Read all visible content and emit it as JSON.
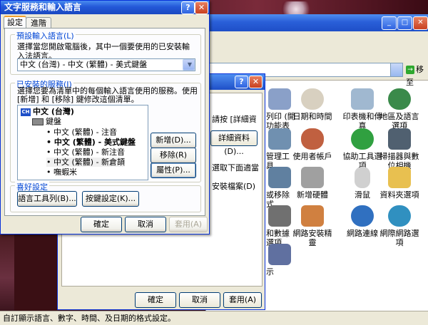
{
  "dialog": {
    "title": "文字服務和輸入語言",
    "help_glyph": "?",
    "close_glyph": "✕",
    "tabs": [
      {
        "label": "設定"
      },
      {
        "label": "進階"
      }
    ],
    "default_group": {
      "label": "預設輸入語言(L)",
      "description": "選擇當您開啟電腦後，其中一個要使用的已安裝輸入法語言。",
      "selected": "中文 (台灣) - 中文 (繁體) - 美式鍵盤"
    },
    "services_group": {
      "label": "已安裝的服務(I)",
      "description": "選擇您要為清單中的每個輸入語言使用的服務。使用 [新增] 和 [移除] 鍵修改這個清單。",
      "language": "中文 (台灣)",
      "language_code": "CH",
      "category": "鍵盤",
      "items": [
        {
          "text": "中文 (繁體) - 注音",
          "bold": false
        },
        {
          "text": "中文 (繁體) - 美式鍵盤",
          "bold": true
        },
        {
          "text": "中文 (繁體) - 新注音",
          "bold": false
        },
        {
          "text": "中文 (繁體) - 新倉頡",
          "bold": false
        },
        {
          "text": "嘸蝦米",
          "bold": false
        }
      ],
      "add_button": "新增(D)...",
      "remove_button": "移除(R)",
      "properties_button": "屬性(P)..."
    },
    "preferences_group": {
      "label": "喜好設定",
      "language_bar_button": "語言工具列(B)...",
      "key_settings_button": "按鍵設定(K)..."
    },
    "ok_button": "確定",
    "cancel_button": "取消",
    "apply_button": "套用(A)"
  },
  "middle_dialog": {
    "help_glyph": "?",
    "close_glyph": "✕",
    "text_1": "請按 [詳細資",
    "details_button": "詳細資料(D)...",
    "text_2": "選取下面適當",
    "text_3": "安裝檔案(D)",
    "ok_button": "確定",
    "cancel_button": "取消",
    "apply_button": "套用(A)"
  },
  "control_panel": {
    "min_glyph": "_",
    "max_glyph": "□",
    "close_glyph": "✕",
    "go_label": "移至",
    "go_glyph": "→",
    "icons": [
      {
        "label": "列印 (開\n功能表",
        "color": "#8aa0c8"
      },
      {
        "label": "日期和時間",
        "color": "#d8d0c0"
      },
      {
        "label": "印表機和傳\n真",
        "color": "#a0b8d0"
      },
      {
        "label": "地區及語言\n選項",
        "color": "#3a8a4a"
      },
      {
        "label": "管理工\n具",
        "color": "#7090b0"
      },
      {
        "label": "使用者帳戶",
        "color": "#c06040"
      },
      {
        "label": "協助工具選\n項",
        "color": "#30a040"
      },
      {
        "label": "掃描器與數\n位相機",
        "color": "#506070"
      },
      {
        "label": "或移除\n式",
        "color": "#6080a0"
      },
      {
        "label": "新增硬體",
        "color": "#a0a0a0"
      },
      {
        "label": "滑鼠",
        "color": "#d0d0d0"
      },
      {
        "label": "資料夾選項",
        "color": "#e8c050"
      },
      {
        "label": "和數據\n選項",
        "color": "#707070"
      },
      {
        "label": "網路安裝精\n靈",
        "color": "#d08040"
      },
      {
        "label": "網路連線",
        "color": "#3070c0"
      },
      {
        "label": "網際網路選\n項",
        "color": "#3090c0"
      },
      {
        "label": "示",
        "color": "#6070a0"
      }
    ]
  },
  "status_bar": {
    "text": "自訂顯示語言、數字、時間、及日期的格式設定。"
  }
}
